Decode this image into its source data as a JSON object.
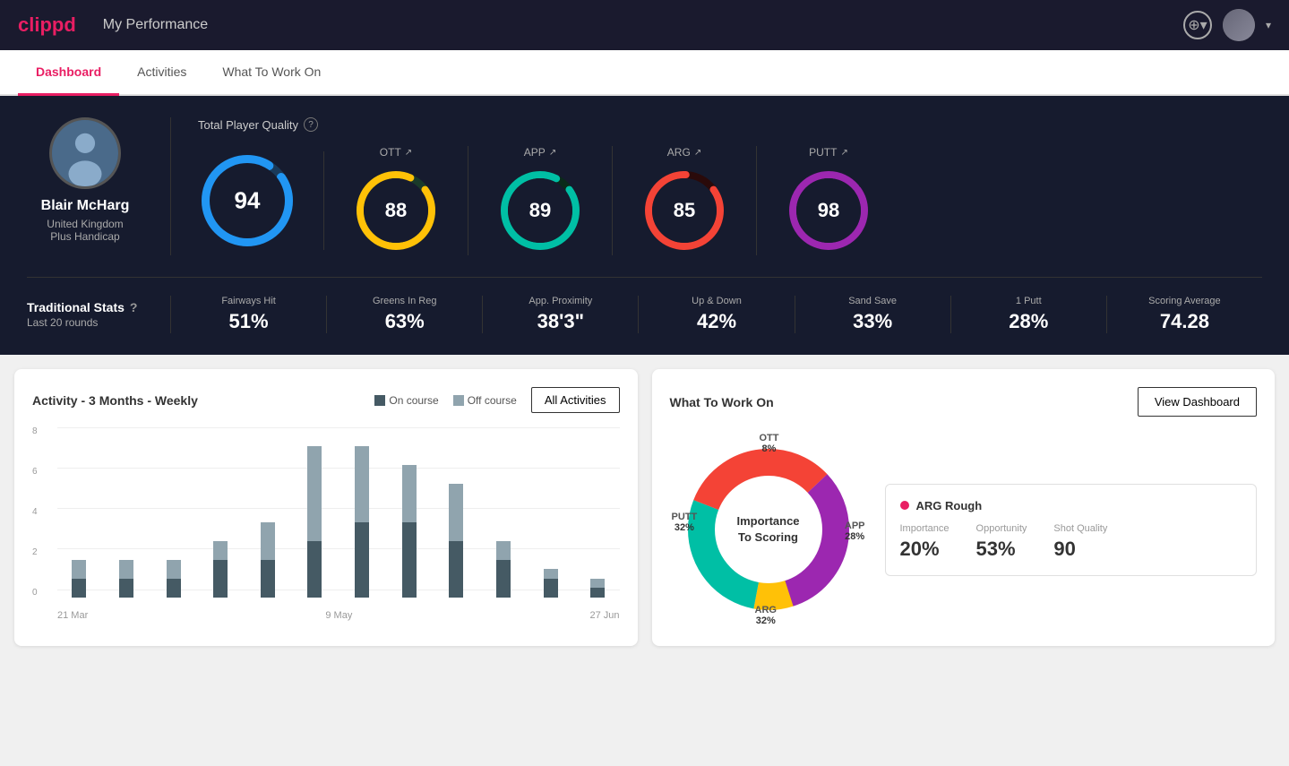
{
  "header": {
    "logo": "clippd",
    "title": "My Performance",
    "add_label": "+",
    "dropdown_label": "▾"
  },
  "nav": {
    "tabs": [
      {
        "label": "Dashboard",
        "active": true
      },
      {
        "label": "Activities",
        "active": false
      },
      {
        "label": "What To Work On",
        "active": false
      }
    ]
  },
  "player": {
    "name": "Blair McHarg",
    "country": "United Kingdom",
    "handicap": "Plus Handicap"
  },
  "quality": {
    "label": "Total Player Quality",
    "main": {
      "value": "94",
      "color": "#2196f3"
    },
    "ott": {
      "label": "OTT",
      "value": "88",
      "color": "#ffc107"
    },
    "app": {
      "label": "APP",
      "value": "89",
      "color": "#00bfa5"
    },
    "arg": {
      "label": "ARG",
      "value": "85",
      "color": "#f44336"
    },
    "putt": {
      "label": "PUTT",
      "value": "98",
      "color": "#9c27b0"
    }
  },
  "trad_stats": {
    "title": "Traditional Stats",
    "subtitle": "Last 20 rounds",
    "fairways_hit": {
      "label": "Fairways Hit",
      "value": "51%"
    },
    "greens_in_reg": {
      "label": "Greens In Reg",
      "value": "63%"
    },
    "app_proximity": {
      "label": "App. Proximity",
      "value": "38'3\""
    },
    "up_and_down": {
      "label": "Up & Down",
      "value": "42%"
    },
    "sand_save": {
      "label": "Sand Save",
      "value": "33%"
    },
    "one_putt": {
      "label": "1 Putt",
      "value": "28%"
    },
    "scoring_avg": {
      "label": "Scoring Average",
      "value": "74.28"
    }
  },
  "activity_chart": {
    "title": "Activity - 3 Months - Weekly",
    "legend_on": "On course",
    "legend_off": "Off course",
    "all_activities_btn": "All Activities",
    "y_labels": [
      "8",
      "6",
      "4",
      "2",
      "0"
    ],
    "x_labels": [
      "21 Mar",
      "9 May",
      "27 Jun"
    ],
    "bars": [
      {
        "on": 1,
        "off": 1
      },
      {
        "on": 1,
        "off": 1
      },
      {
        "on": 1,
        "off": 1
      },
      {
        "on": 2,
        "off": 1
      },
      {
        "on": 2,
        "off": 2
      },
      {
        "on": 3,
        "off": 5
      },
      {
        "on": 4,
        "off": 4
      },
      {
        "on": 4,
        "off": 3
      },
      {
        "on": 3,
        "off": 3
      },
      {
        "on": 2,
        "off": 1
      },
      {
        "on": 1,
        "off": 0.5
      },
      {
        "on": 0.5,
        "off": 0.5
      }
    ]
  },
  "what_to_work_on": {
    "title": "What To Work On",
    "view_dashboard_btn": "View Dashboard",
    "donut_center_line1": "Importance",
    "donut_center_line2": "To Scoring",
    "segments": [
      {
        "label": "OTT",
        "pct": "8%",
        "color": "#ffc107"
      },
      {
        "label": "APP",
        "pct": "28%",
        "color": "#00bfa5"
      },
      {
        "label": "ARG",
        "pct": "32%",
        "color": "#f44336"
      },
      {
        "label": "PUTT",
        "pct": "32%",
        "color": "#9c27b0"
      }
    ],
    "detail_card": {
      "title": "ARG Rough",
      "dot_color": "#e91e63",
      "importance_label": "Importance",
      "importance_value": "20%",
      "opportunity_label": "Opportunity",
      "opportunity_value": "53%",
      "shot_quality_label": "Shot Quality",
      "shot_quality_value": "90"
    }
  }
}
